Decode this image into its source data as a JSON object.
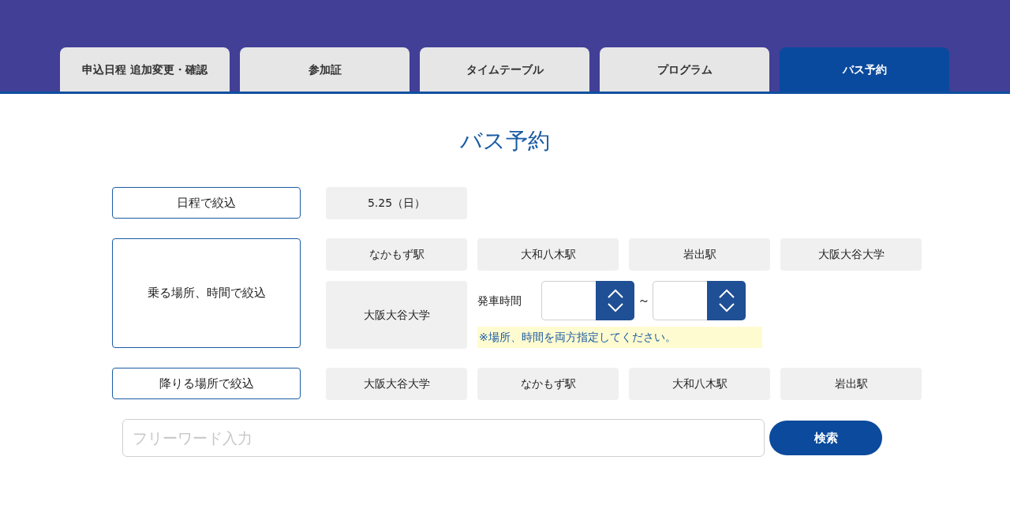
{
  "tabs": [
    {
      "label": "申込日程 追加変更・確認",
      "selected": false
    },
    {
      "label": "参加証",
      "selected": false
    },
    {
      "label": "タイムテーブル",
      "selected": false
    },
    {
      "label": "プログラム",
      "selected": false
    },
    {
      "label": "バス予約",
      "selected": true
    }
  ],
  "title": "バス予約",
  "filters": [
    {
      "kind": "options",
      "label": "日程で絞込",
      "options": [
        "5.25（日）"
      ]
    },
    {
      "kind": "boarding",
      "label": "乗る場所、時間で絞込",
      "options": [
        "なかもず駅",
        "大和八木駅",
        "岩出駅",
        "大阪大谷大学"
      ],
      "place": "大阪大谷大学",
      "time_label": "発車時間",
      "range_separator": "～",
      "note": "※場所、時間を両方指定してください。"
    },
    {
      "kind": "options",
      "label": "降りる場所で絞込",
      "options": [
        "大阪大谷大学",
        "なかもず駅",
        "大和八木駅",
        "岩出駅"
      ]
    }
  ],
  "search": {
    "placeholder": "フリーワード入力",
    "button": "検索"
  }
}
